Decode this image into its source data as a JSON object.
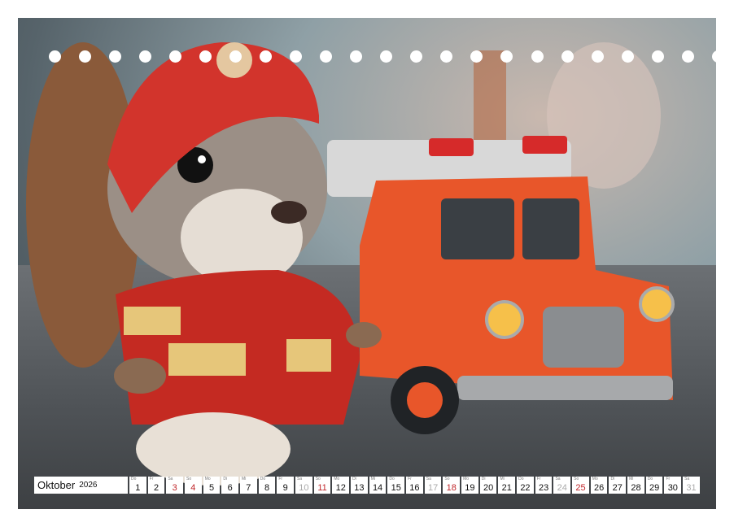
{
  "calendar": {
    "month": "Oktober",
    "year": "2026",
    "days": [
      {
        "wd": "Do",
        "n": "1",
        "t": ""
      },
      {
        "wd": "Fr",
        "n": "2",
        "t": ""
      },
      {
        "wd": "Sa",
        "n": "3",
        "t": "sun"
      },
      {
        "wd": "So",
        "n": "4",
        "t": "sun"
      },
      {
        "wd": "Mo",
        "n": "5",
        "t": ""
      },
      {
        "wd": "Di",
        "n": "6",
        "t": ""
      },
      {
        "wd": "Mi",
        "n": "7",
        "t": ""
      },
      {
        "wd": "Do",
        "n": "8",
        "t": ""
      },
      {
        "wd": "Fr",
        "n": "9",
        "t": ""
      },
      {
        "wd": "Sa",
        "n": "10",
        "t": "sat"
      },
      {
        "wd": "So",
        "n": "11",
        "t": "sun"
      },
      {
        "wd": "Mo",
        "n": "12",
        "t": ""
      },
      {
        "wd": "Di",
        "n": "13",
        "t": ""
      },
      {
        "wd": "Mi",
        "n": "14",
        "t": ""
      },
      {
        "wd": "Do",
        "n": "15",
        "t": ""
      },
      {
        "wd": "Fr",
        "n": "16",
        "t": ""
      },
      {
        "wd": "Sa",
        "n": "17",
        "t": "sat"
      },
      {
        "wd": "So",
        "n": "18",
        "t": "sun"
      },
      {
        "wd": "Mo",
        "n": "19",
        "t": ""
      },
      {
        "wd": "Di",
        "n": "20",
        "t": ""
      },
      {
        "wd": "Mi",
        "n": "21",
        "t": ""
      },
      {
        "wd": "Do",
        "n": "22",
        "t": ""
      },
      {
        "wd": "Fr",
        "n": "23",
        "t": ""
      },
      {
        "wd": "Sa",
        "n": "24",
        "t": "sat"
      },
      {
        "wd": "So",
        "n": "25",
        "t": "sun"
      },
      {
        "wd": "Mo",
        "n": "26",
        "t": ""
      },
      {
        "wd": "Di",
        "n": "27",
        "t": ""
      },
      {
        "wd": "Mi",
        "n": "28",
        "t": ""
      },
      {
        "wd": "Do",
        "n": "29",
        "t": ""
      },
      {
        "wd": "Fr",
        "n": "30",
        "t": ""
      },
      {
        "wd": "Sa",
        "n": "31",
        "t": "sat"
      }
    ]
  },
  "colors": {
    "sunday": "#c0262a",
    "saturday": "#aaaaaa",
    "truck": "#e8562a",
    "jacket": "#c42a22"
  },
  "illustration": {
    "subject": "squirrel-firefighter",
    "vehicle": "fire-truck-toy"
  }
}
